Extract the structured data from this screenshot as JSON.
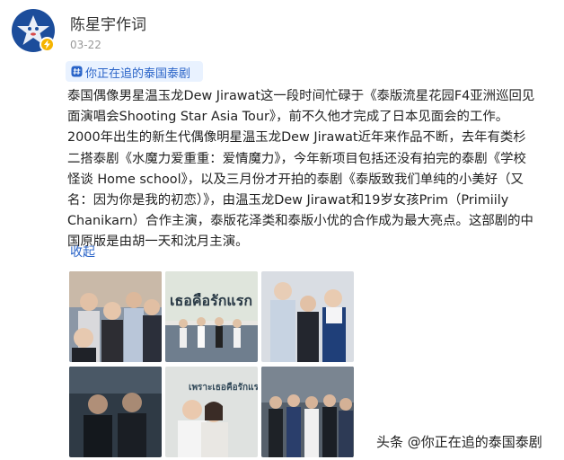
{
  "author": {
    "name": "陈星宇作词",
    "date": "03-22",
    "avatar_icon": "star-avatar-icon",
    "badge_icon": "verified-lightning-icon"
  },
  "topic": {
    "label": "你正在追的泰国泰剧",
    "icon": "topic-hash-icon"
  },
  "post": {
    "lines": [
      "泰国偶像男星温玉龙Dew Jirawat这一段时间忙碌于《泰版流星花园F4亚洲巡回见",
      "面演唱会Shooting Star Asia Tour》，前不久他才完成了日本见面会的工作。",
      "2000年出生的新生代偶像明星温玉龙Dew Jirawat近年来作品不断，去年有类杉",
      "二搭泰剧《水魔力爱重重：爱情魔力》，今年新项目包括还没有拍完的泰剧《学校",
      "怪谈 Home school》，以及三月份才开拍的泰剧《泰版致我们单纯的小美好（又",
      "名：因为你是我的初恋）》，由温玉龙Dew Jirawat和19岁女孩Prim（Primiily",
      "Chanikarn）合作主演，泰版花泽类和泰版小优的合作成为最大亮点。这部剧的中",
      "国原版是由胡一天和沈月主演。"
    ],
    "collapse_label": "收起"
  },
  "photos": {
    "p2_text": "เธอคือรักแรก",
    "p5_text": "เพราะเธอคือรักแรก"
  },
  "watermark": "头条 @你正在追的泰国泰剧",
  "colors": {
    "link_blue": "#2a64c8",
    "tag_bg": "#e9f2ff",
    "avatar_bg": "#1c4d9b",
    "badge": "#f5b400"
  }
}
